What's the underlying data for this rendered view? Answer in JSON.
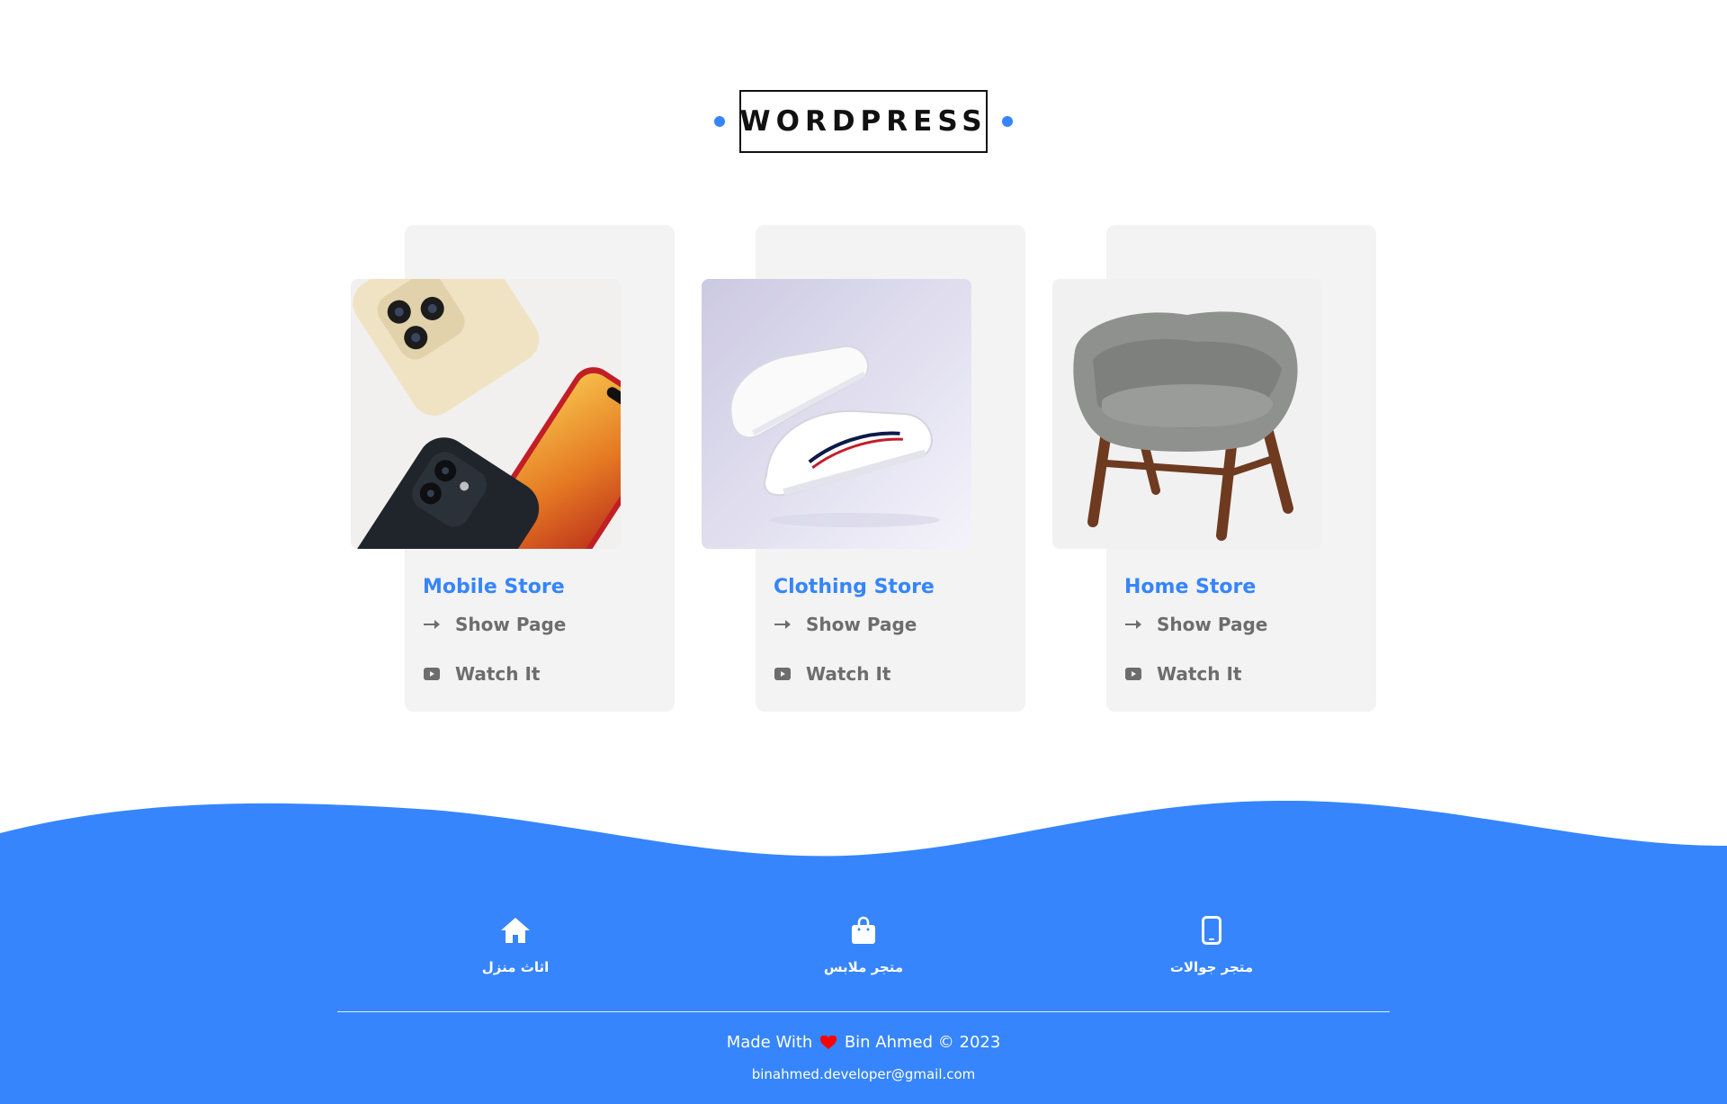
{
  "header": {
    "title": "WORDPRESS"
  },
  "cards": [
    {
      "title": "Mobile Store",
      "show_label": "Show Page",
      "watch_label": "Watch It",
      "image_icon": "phones-image"
    },
    {
      "title": "Clothing Store",
      "show_label": "Show Page",
      "watch_label": "Watch It",
      "image_icon": "sneakers-image"
    },
    {
      "title": "Home Store",
      "show_label": "Show Page",
      "watch_label": "Watch It",
      "image_icon": "armchair-image"
    }
  ],
  "footer": {
    "nav": [
      {
        "label": "اثاث منزل",
        "icon": "home-icon"
      },
      {
        "label": "متجر ملابس",
        "icon": "shopping-bag-icon"
      },
      {
        "label": "متجر جوالات",
        "icon": "mobile-phone-icon"
      }
    ],
    "credit_prefix": "Made With",
    "credit_suffix": "Bin Ahmed © 2023",
    "email": "binahmed.developer@gmail.com"
  },
  "colors": {
    "accent": "#3685fc",
    "card_bg": "#f3f3f3",
    "link_text": "#6d6d6d",
    "heart": "#ff0000"
  }
}
